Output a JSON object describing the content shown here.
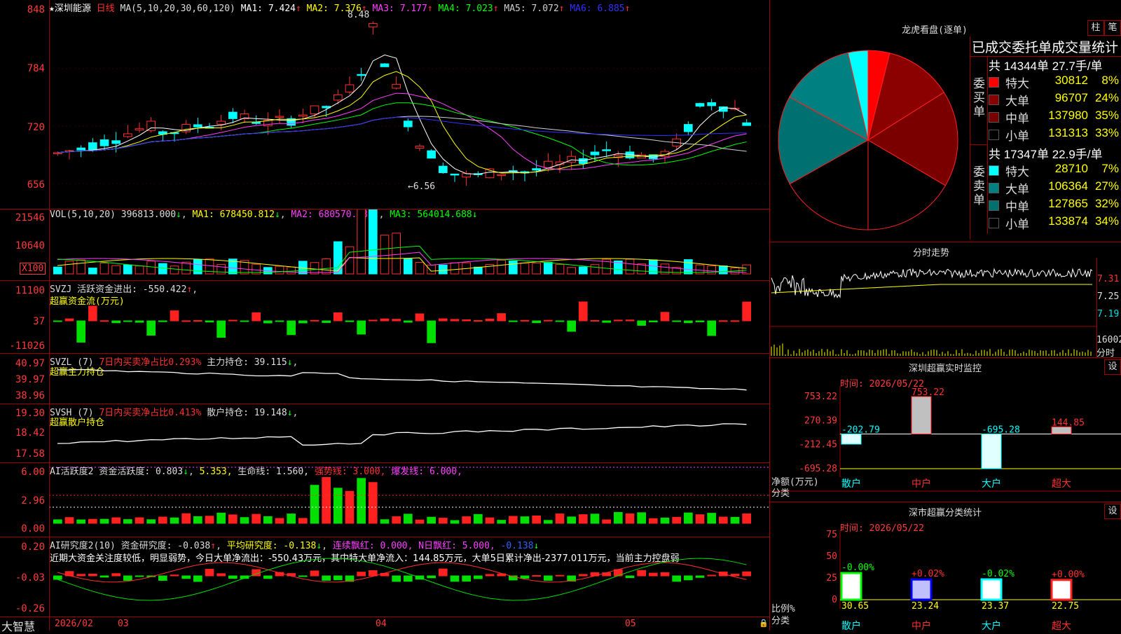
{
  "main": {
    "stock_name": "★深圳能源",
    "period": "日线",
    "ma_params": "MA(5,10,20,30,60,120)",
    "ma": [
      {
        "label": "MA1:",
        "value": "7.424",
        "arrow": "↑",
        "color": "#ffffff"
      },
      {
        "label": "MA2:",
        "value": "7.376",
        "arrow": "↑",
        "color": "#ffff00"
      },
      {
        "label": "MA3:",
        "value": "7.177",
        "arrow": "↑",
        "color": "#ff40ff"
      },
      {
        "label": "MA4:",
        "value": "7.023",
        "arrow": "↑",
        "color": "#00ff00"
      },
      {
        "label": "MA5:",
        "value": "7.072",
        "arrow": "↑",
        "color": "#d0d0d0"
      },
      {
        "label": "MA6:",
        "value": "6.885",
        "arrow": "↑",
        "color": "#3030ff"
      }
    ],
    "y_ticks": [
      "848",
      "784",
      "720",
      "656"
    ],
    "high_label": "8.48",
    "low_label": "←6.56"
  },
  "vol": {
    "header": "VOL(5,10,20)",
    "value": "396813.000",
    "ma1": "678450.812",
    "ma2": "680570.688",
    "ma3": "564014.688",
    "y_ticks": [
      "21546",
      "10640"
    ],
    "unit": "X100"
  },
  "svzj": {
    "line1": "SVZJ  活跃资金进出: -550.422",
    "line2": "超赢资金流(万元)",
    "y_ticks": [
      "11100",
      "37",
      "-11026"
    ]
  },
  "svzl": {
    "name": "SVZL (7)",
    "pct": "7日内买卖净占比0.293%",
    "hold": "主力持仓: 39.115",
    "line2": "超赢主力持仓",
    "y_ticks": [
      "40.97",
      "39.97",
      "38.96"
    ]
  },
  "svsh": {
    "name": "SVSH (7)",
    "pct": "7日内买卖净占比0.413%",
    "hold": "散户持仓: 19.148",
    "line2": "超赢散户持仓",
    "y_ticks": [
      "19.30",
      "18.42",
      "17.58"
    ]
  },
  "ai1": {
    "name": "AI活跃度2",
    "a": "资金活跃度: 0.803",
    "b": "5.353,",
    "c": "生命线: 1.560,",
    "d": "强势线: 3.000,",
    "e": "爆发线: 6.000,",
    "y_ticks": [
      "6.00",
      "2.96",
      "0.00"
    ]
  },
  "ai2": {
    "name": "AI研究度2(10)",
    "a": "资金研究度: -0.038",
    "b": "平均研究度: -0.138",
    "c": "连续飘红: 0.000,",
    "d": "N日飘红: 5.000,",
    "e": "-0.138",
    "commentary": "近期大资金关注度较低，明显弱势，今日大单净流出：-550.43万元，其中特大单净流入：144.85万元，大单5日累计净出-2377.011万元，当前主力控盘弱",
    "y_ticks": [
      "0.20",
      "-0.03",
      "-0.26"
    ]
  },
  "bottom": {
    "logo": "大智慧",
    "date1": "2026/02",
    "m3": "03",
    "m4": "04",
    "m5": "05"
  },
  "lhb": {
    "title": "龙虎看盘(逐单)",
    "btn1": "柱",
    "btn2": "笔",
    "stat_title": "已成交委托单成交量统计",
    "buy_label": "委买单",
    "sell_label": "委卖单",
    "buy_summary": "共 14344单 27.7手/单",
    "sell_summary": "共 17347单 22.9手/单",
    "buy_rows": [
      {
        "name": "特大",
        "vol": "30812",
        "pct": "8%",
        "color": "#ff0000"
      },
      {
        "name": "大单",
        "vol": "96707",
        "pct": "24%",
        "color": "#8b0000"
      },
      {
        "name": "中单",
        "vol": "137980",
        "pct": "35%",
        "color": "#7a0000"
      },
      {
        "name": "小单",
        "vol": "131313",
        "pct": "33%",
        "color": "#000000"
      }
    ],
    "sell_rows": [
      {
        "name": "特大",
        "vol": "28710",
        "pct": "7%",
        "color": "#00ffff"
      },
      {
        "name": "大单",
        "vol": "106364",
        "pct": "27%",
        "color": "#008080"
      },
      {
        "name": "中单",
        "vol": "127865",
        "pct": "32%",
        "color": "#007070"
      },
      {
        "name": "小单",
        "vol": "133874",
        "pct": "34%",
        "color": "#000000"
      }
    ]
  },
  "fenshi": {
    "title": "分时走势",
    "p1": "7.31",
    "p2": "7.25",
    "p3": "7.19",
    "vol": "16002",
    "unit": "分时"
  },
  "monitor": {
    "title": "深圳超赢实时监控",
    "btn": "设",
    "time": "时间: 2026/05/22",
    "y_ticks": [
      "753.22",
      "270.39",
      "-212.45",
      "-695.28"
    ],
    "ylabel": "净额(万元)",
    "xlabel": "分类",
    "cats": [
      "散户",
      "中户",
      "大户",
      "超大"
    ],
    "values": [
      -202.79,
      753.22,
      -695.28,
      144.85
    ],
    "value_labels": [
      "-202.79",
      "753.22",
      "-695.28",
      "144.85"
    ]
  },
  "classify": {
    "title": "深市超赢分类统计",
    "btn": "设",
    "time": "时间: 2026/05/22",
    "y_ticks": [
      "75",
      "50",
      "25",
      "0"
    ],
    "ylabel": "比例%",
    "xlabel": "分类",
    "cats": [
      "散户",
      "中户",
      "大户",
      "超大"
    ],
    "values": [
      30.65,
      23.24,
      23.37,
      22.75
    ],
    "changes": [
      "-0.00%",
      "+0.02%",
      "-0.02%",
      "+0.00%"
    ]
  },
  "chart_data": [
    {
      "type": "bar",
      "title": "深圳超赢实时监控",
      "categories": [
        "散户",
        "中户",
        "大户",
        "超大"
      ],
      "values": [
        -202.79,
        753.22,
        -695.28,
        144.85
      ],
      "ylabel": "净额(万元)",
      "ylim": [
        -695.28,
        753.22
      ]
    },
    {
      "type": "bar",
      "title": "深市超赢分类统计",
      "categories": [
        "散户",
        "中户",
        "大户",
        "超大"
      ],
      "values": [
        30.65,
        23.24,
        23.37,
        22.75
      ],
      "ylabel": "比例%",
      "ylim": [
        0,
        75
      ]
    },
    {
      "type": "pie",
      "title": "龙虎看盘(逐单)",
      "categories": [
        "买特大",
        "买大单",
        "买中单",
        "买小单",
        "卖特大",
        "卖大单",
        "卖中单",
        "卖小单"
      ],
      "values": [
        30812,
        96707,
        137980,
        131313,
        28710,
        106364,
        127865,
        133874
      ]
    }
  ]
}
